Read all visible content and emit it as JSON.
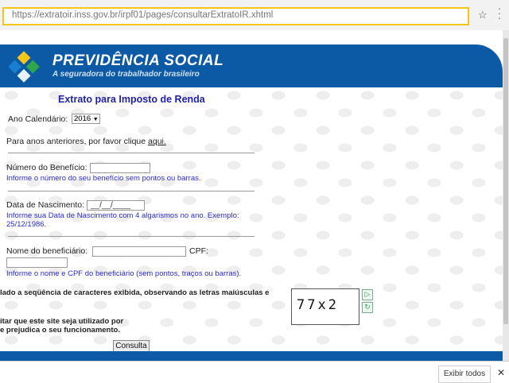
{
  "browser": {
    "url": "https://extratoir.inss.gov.br/irpf01/pages/consultarExtratoIR.xhtml",
    "download_bar": {
      "show_all_label": "Exibir todos",
      "close_label": "✕"
    }
  },
  "header": {
    "brand": "PREVIDÊNCIA SOCIAL",
    "tagline": "A seguradora do trabalhador brasileiro"
  },
  "form": {
    "title": "Extrato para Imposto de Renda",
    "year_label": "Ano Calendário:",
    "year_value": "2016",
    "previous_text": "Para anos anteriores, por favor clique",
    "previous_link": "aqui.",
    "benefit_label": "Número do Benefício:",
    "benefit_value": "",
    "benefit_hint": "Informe o número do seu benefício sem pontos ou barras.",
    "birth_label": "Data de Nascimento:",
    "birth_value": "__/__/____",
    "birth_hint_1": "Informe sua Data de Nascimento com 4 algarismos no ano. Exemplo:",
    "birth_hint_2": "25/12/1986.",
    "name_label": "Nome do beneficiário:",
    "name_value": "",
    "cpf_label": "CPF:",
    "cpf_value": "",
    "name_hint": "Informe o nome e CPF do beneficiário (sem pontos, traços ou barras).",
    "captcha_instruction": "lado a seqüência de caracteres exibida, observando as letras maiúsculas e",
    "captcha_text": "77x2",
    "captcha_reason_1": "itar que este site seja utilizado por",
    "captcha_reason_2": "e prejudica o seu funcionamento.",
    "submit_label": "Consulta"
  },
  "colors": {
    "banner": "#0c5aa6",
    "title": "#1f1fa8",
    "hint": "#2b2bd0",
    "url_highlight": "#f5c518"
  },
  "icons": [
    "star-icon",
    "menu-icon",
    "previdencia-logo",
    "refresh-captcha-icon",
    "audio-captcha-icon",
    "close-icon"
  ]
}
